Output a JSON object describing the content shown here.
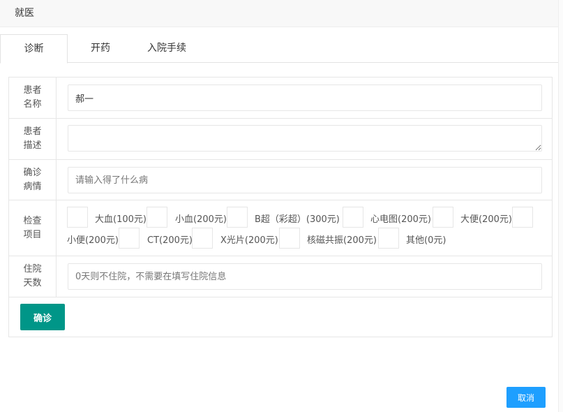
{
  "dialog": {
    "title": "就医"
  },
  "tabs": [
    {
      "label": "诊断",
      "active": true
    },
    {
      "label": "开药",
      "active": false
    },
    {
      "label": "入院手续",
      "active": false
    }
  ],
  "form": {
    "patient_name": {
      "label": "患者名称",
      "value": "郝一"
    },
    "patient_desc": {
      "label": "患者描述",
      "value": ""
    },
    "diagnosis": {
      "label": "确诊病情",
      "placeholder": "请输入得了什么病"
    },
    "exams": {
      "label": "检查项目",
      "items": [
        "大血(100元)",
        "小血(200元)",
        "B超（彩超）(300元)",
        "心电图(200元)",
        "大便(200元)",
        "小便(200元)",
        "CT(200元)",
        "X光片(200元)",
        "核磁共振(200元)",
        "其他(0元)"
      ]
    },
    "hospital_days": {
      "label": "住院天数",
      "placeholder": "0天则不住院，不需要在填写住院信息"
    }
  },
  "buttons": {
    "confirm": "确诊",
    "cancel": "取消"
  },
  "colors": {
    "confirm_bg": "#009688",
    "cancel_bg": "#1e9fff"
  }
}
